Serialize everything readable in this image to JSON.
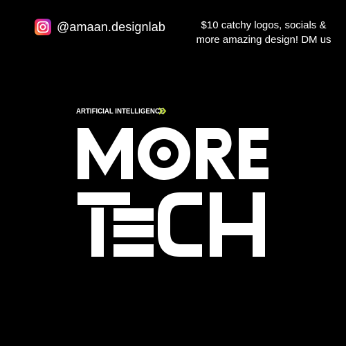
{
  "instagram": {
    "icon": "instagram-icon",
    "handle": "@amaan.designlab"
  },
  "promo": {
    "line1": "$10 catchy logos, socials &",
    "line2": "more amazing design! DM us"
  },
  "design": {
    "tagline": "ARTIFICIAL INTELLIGENCE",
    "tagline_icon": "double-chevron-right-icon",
    "tagline_icon_color": "#c8e63c",
    "headline_line1": "MORE",
    "headline_line2": "TECH"
  },
  "colors": {
    "background": "#000000",
    "text": "#ffffff",
    "accent": "#c8e63c"
  }
}
